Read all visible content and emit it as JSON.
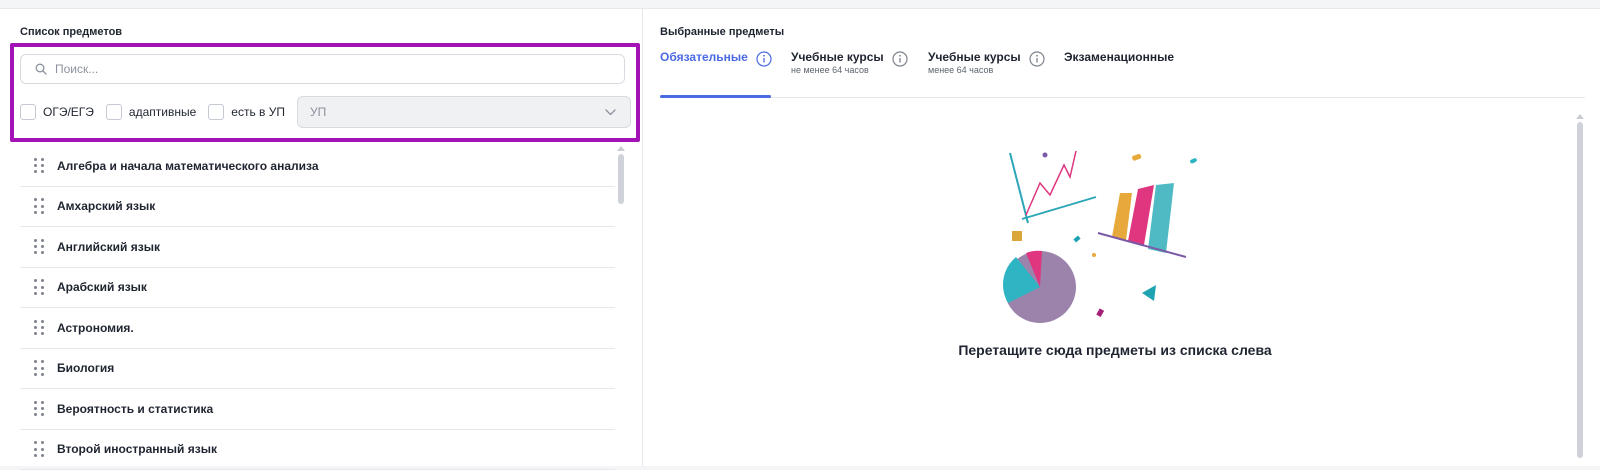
{
  "left_panel": {
    "title": "Список предметов",
    "search": {
      "placeholder": "Поиск...",
      "value": ""
    },
    "filters": [
      {
        "label": "ОГЭ/ЕГЭ",
        "checked": false
      },
      {
        "label": "адаптивные",
        "checked": false
      },
      {
        "label": "есть в УП",
        "checked": false
      }
    ],
    "select": {
      "value": "УП"
    },
    "items": [
      "Алгебра и начала математического анализа",
      "Амхарский язык",
      "Английский язык",
      "Арабский язык",
      "Астрономия.",
      "Биология",
      "Вероятность и статистика",
      "Второй иностранный язык"
    ]
  },
  "right_panel": {
    "title": "Выбранные предметы",
    "tabs": [
      {
        "label": "Обязательные",
        "sub": "",
        "active": true
      },
      {
        "label": "Учебные курсы",
        "sub": "не менее 64 часов",
        "active": false
      },
      {
        "label": "Учебные курсы",
        "sub": "менее 64 часов",
        "active": false
      },
      {
        "label": "Экзаменационные",
        "sub": "",
        "active": false
      }
    ],
    "empty_state": {
      "message": "Перетащите сюда предметы из списка слева"
    }
  },
  "colors": {
    "accent": "#4a6ae3",
    "highlight": "#a312b4"
  },
  "icons": [
    "search-icon",
    "drag-handle-icon",
    "chevron-down-icon",
    "info-icon",
    "empty-state-chart-illustration"
  ]
}
